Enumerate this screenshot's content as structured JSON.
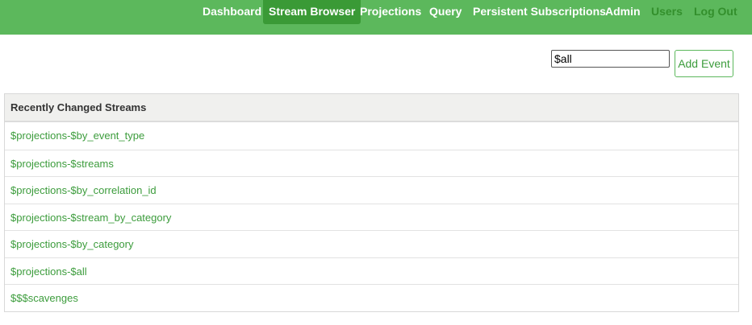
{
  "nav": {
    "items": [
      {
        "label": "Dashboard"
      },
      {
        "label": "Stream Browser"
      },
      {
        "label": "Projections"
      },
      {
        "label": "Query"
      },
      {
        "label": "Persistent Subscriptions"
      },
      {
        "label": "Admin"
      },
      {
        "label": "Users"
      },
      {
        "label": "Log Out"
      }
    ],
    "active": "Stream Browser"
  },
  "search": {
    "value": "$all",
    "placeholder": ""
  },
  "toolbar": {
    "add_event_label": "Add Event"
  },
  "streams_table": {
    "header": "Recently Changed Streams",
    "rows": [
      "$projections-$by_event_type",
      "$projections-$streams",
      "$projections-$by_correlation_id",
      "$projections-$stream_by_category",
      "$projections-$by_category",
      "$projections-$all",
      "$$$scavenges"
    ]
  },
  "colors": {
    "nav_bg": "#5cb85c",
    "nav_active_bg": "#3a9a36",
    "nav_muted_text": "#338f2c",
    "link": "#3c9c3c",
    "header_bg": "#f0f0ee"
  }
}
